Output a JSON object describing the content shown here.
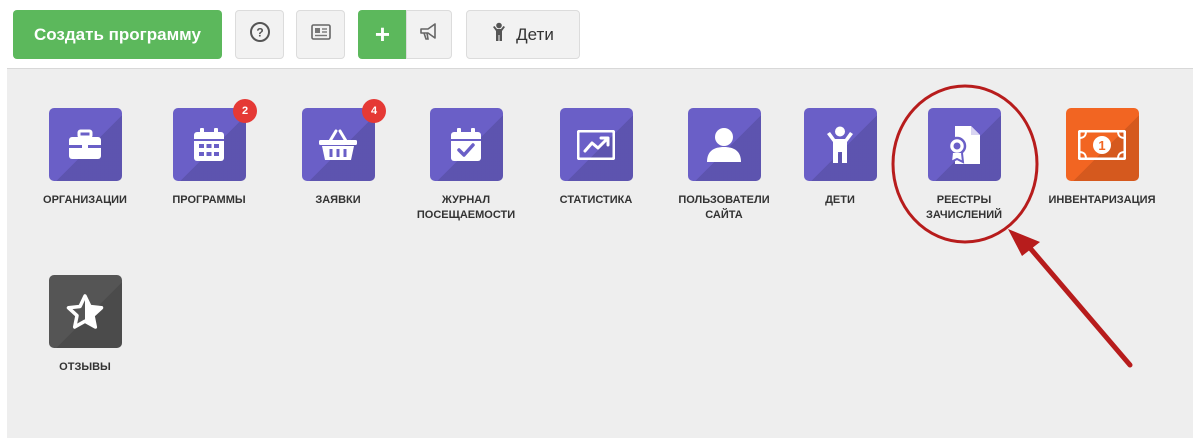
{
  "toolbar": {
    "create_program_label": "Создать программу",
    "help_icon": "question-circle-icon",
    "card_icon": "id-card-icon",
    "add_label": "+",
    "announce_icon": "megaphone-icon",
    "children_label": "Дети",
    "children_icon": "child-icon"
  },
  "tiles": [
    {
      "label": "ОРГАНИЗАЦИИ",
      "icon": "briefcase-icon"
    },
    {
      "label": "ПРОГРАММЫ",
      "icon": "calendar-icon",
      "badge": "2"
    },
    {
      "label": "ЗАЯВКИ",
      "icon": "basket-icon",
      "badge": "4"
    },
    {
      "label_line1": "ЖУРНАЛ",
      "label_line2": "ПОСЕЩАЕМОСТИ",
      "icon": "calendar-check-icon"
    },
    {
      "label": "СТАТИСТИКА",
      "icon": "chart-line-icon"
    },
    {
      "label_line1": "ПОЛЬЗОВАТЕЛИ",
      "label_line2": "САЙТА",
      "icon": "user-icon"
    },
    {
      "label": "ДЕТИ",
      "icon": "child-icon"
    },
    {
      "label_line1": "РЕЕСТРЫ",
      "label_line2": "ЗАЧИСЛЕНИЙ",
      "icon": "certificate-document-icon"
    },
    {
      "label": "ИНВЕНТАРИЗАЦИЯ",
      "icon": "money-bill-icon"
    },
    {
      "label": "ОТЗЫВЫ",
      "icon": "star-icon"
    }
  ],
  "colors": {
    "green": "#5cb85c",
    "purple": "#6a5fc7",
    "orange": "#f26522",
    "dark_grey": "#555555",
    "badge_red": "#e53935",
    "annotation_red": "#b71c1c"
  }
}
